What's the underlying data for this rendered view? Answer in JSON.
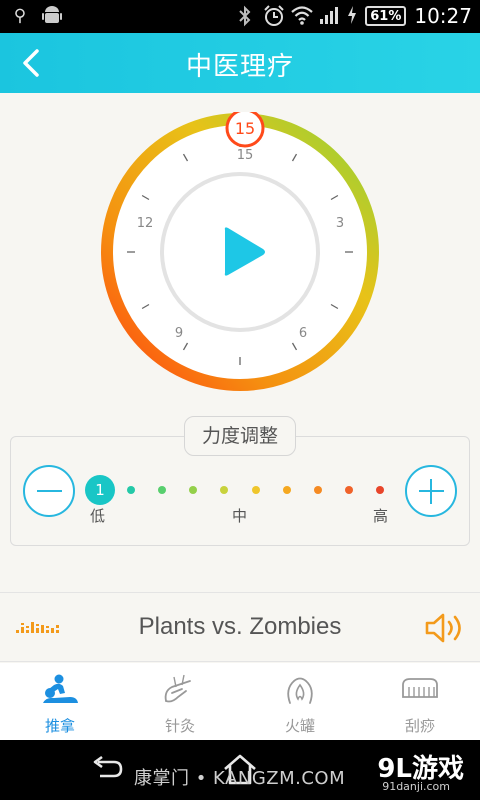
{
  "status_bar": {
    "time": "10:27",
    "battery": "61%",
    "left_icons": [
      "usb-icon",
      "android-icon"
    ],
    "right_icons": [
      "bluetooth-icon",
      "alarm-icon",
      "wifi-icon",
      "signal-icon",
      "charging-icon"
    ]
  },
  "header": {
    "title": "中医理疗",
    "back_icon": "chevron-left-icon"
  },
  "timer": {
    "selected_value": "15",
    "ticks": {
      "top": "15",
      "right": "3",
      "bottom_right": "6",
      "bottom_left": "9",
      "left": "12"
    },
    "play_icon": "play-icon",
    "colors": {
      "ring_start": "#7ed23a",
      "ring_mid": "#f4a000",
      "ring_end": "#ff3a10",
      "play": "#1ec7e6"
    }
  },
  "force": {
    "label": "力度调整",
    "current_level": "1",
    "level_count": 10,
    "low_label": "低",
    "mid_label": "中",
    "high_label": "高",
    "dot_colors": [
      "#19c6c6",
      "#24c9a8",
      "#58cf6e",
      "#94d04a",
      "#c8d23c",
      "#efc62c",
      "#f5a820",
      "#f58a22",
      "#f0622a",
      "#e8452a"
    ],
    "accent": "#27b7df"
  },
  "now_playing": {
    "title": "Plants vs. Zombies",
    "eq_icon": "equalizer-icon",
    "speaker_icon": "speaker-icon",
    "accent": "#f39a1b"
  },
  "tabs": [
    {
      "label": "推拿",
      "icon": "massage-icon",
      "active": true
    },
    {
      "label": "针灸",
      "icon": "acupuncture-icon",
      "active": false
    },
    {
      "label": "火罐",
      "icon": "cupping-icon",
      "active": false
    },
    {
      "label": "刮痧",
      "icon": "scraping-icon",
      "active": false
    }
  ],
  "nav": {
    "back_icon": "nav-back-icon",
    "home_icon": "nav-home-icon"
  },
  "watermarks": {
    "site": "康掌门 • KANGZM.COM",
    "logo": "9L游戏",
    "logo_sub": "91danji.com"
  }
}
